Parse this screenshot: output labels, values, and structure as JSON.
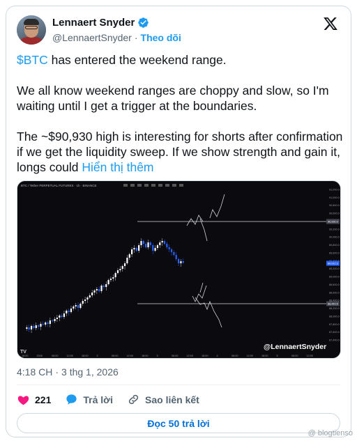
{
  "author": {
    "display_name": "Lennaert Snyder",
    "handle": "@LennaertSnyder",
    "separator": "·",
    "follow_label": "Theo dõi"
  },
  "tweet": {
    "cashtag": "$BTC",
    "line1_rest": " has entered the weekend range.",
    "para2": "We all know weekend ranges are choppy and slow, so I'm waiting until I get a trigger at the boundaries.",
    "para3": "The ~$90,930 high is interesting for shorts after confirmation if we get the liquidity sweep. If we show strength and gain it, longs could ",
    "show_more": "Hiển thị thêm"
  },
  "chart": {
    "header_text": "BTC / Tether PERPETUAL FUTURES · 1h · BINANCE",
    "watermark": "@LennaertSnyder",
    "price_ticks": [
      "91,200.0",
      "91,000.0",
      "90,800.0",
      "90,600.0",
      "90,400.0",
      "90,200.0",
      "90,000.0",
      "89,800.0",
      "89,600.0",
      "89,400.0",
      "89,200.0",
      "89,000.0",
      "88,800.0",
      "88,600.0",
      "88,400.0",
      "88,200.0",
      "88,000.0",
      "87,800.0",
      "87,600.0",
      "87,400.0"
    ],
    "range_high_label": "90,930.0",
    "range_low_label": "88,440.5",
    "current_label": "89,910.3",
    "time_ticks": [
      "16:00",
      "2026",
      "06:00",
      "12:00",
      "18:00",
      "2",
      "06:00",
      "12:00",
      "18:00",
      "3",
      "06:00",
      "12:00",
      "18:00",
      "4",
      "06:00",
      "12:00",
      "18:00",
      "5",
      "06:00",
      "12:00"
    ]
  },
  "meta": {
    "time": "4:18 CH",
    "separator": "·",
    "date": "3 thg 1, 2026"
  },
  "actions": {
    "like_count": "221",
    "reply_label": "Trả lời",
    "copy_link_label": "Sao liên kết"
  },
  "read_replies_label": "Đọc 50 trả lời",
  "page_watermark": "@ blogtienso",
  "colors": {
    "accent": "#1d9bf0",
    "like": "#f91880",
    "chart_bg": "#0b0b0f",
    "candle_up": "#ffffff",
    "candle_down": "#2962ff"
  }
}
